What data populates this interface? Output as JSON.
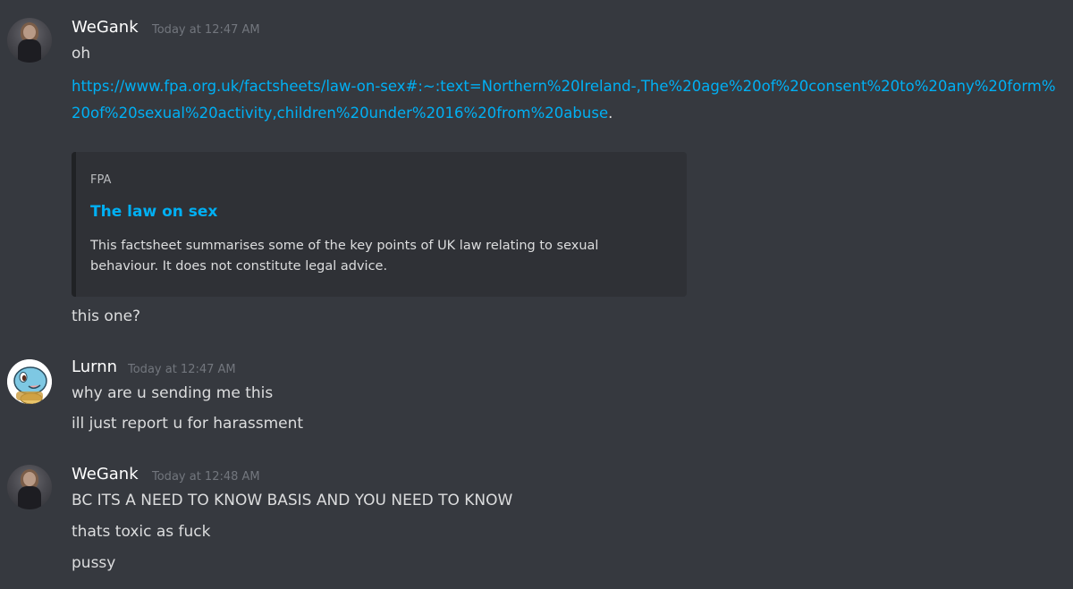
{
  "messages": [
    {
      "author": "WeGank",
      "timestamp": "Today at 12:47 AM",
      "avatar_icon": "profile-photo-avatar",
      "lines": [
        "oh"
      ],
      "link": {
        "url": "https://www.fpa.org.uk/factsheets/law-on-sex#:~:text=Northern%20Ireland-,The%20age%20of%20consent%20to%20any%20form%20of%20sexual%20activity,children%20under%2016%20from%20abuse",
        "trailing": "."
      },
      "embed": {
        "provider": "FPA",
        "title": "The law on sex",
        "description": "This factsheet summarises some of the key points of UK law relating to sexual behaviour. It does not constitute legal advice."
      },
      "after": [
        "this one?"
      ]
    },
    {
      "author": "Lurnn",
      "timestamp": "Today at 12:47 AM",
      "avatar_icon": "squirtle-avatar",
      "lines": [
        "why are u sending me this",
        "ill just report u for harassment"
      ]
    },
    {
      "author": "WeGank",
      "timestamp": "Today at 12:48 AM",
      "avatar_icon": "profile-photo-avatar",
      "lines": [
        "BC ITS A NEED TO KNOW BASIS AND YOU NEED TO KNOW",
        "thats toxic as fuck",
        "pussy"
      ]
    }
  ],
  "colors": {
    "background": "#36393f",
    "link": "#00b0f4",
    "embed_background": "#2f3136",
    "username": "#ffffff",
    "timestamp": "#72767d",
    "text": "#dcddde"
  }
}
